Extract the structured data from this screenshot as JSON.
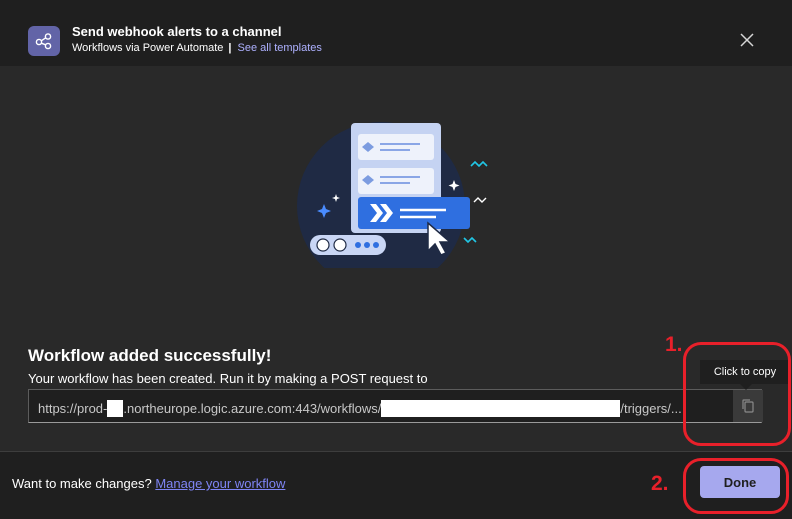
{
  "header": {
    "title": "Send webhook alerts to a channel",
    "subtitle_source": "Workflows via Power Automate",
    "separator": "|",
    "templates_link": "See all templates",
    "close_icon": "close-icon",
    "app_icon": "share-nodes-icon"
  },
  "main": {
    "heading": "Workflow added successfully!",
    "description": "Your workflow has been created. Run it by making a POST request to",
    "url_part1": "https://prod-",
    "url_part2": ".northeurope.logic.azure.com:443/workflows/",
    "url_part3": "/triggers/...",
    "copy_icon": "copy-icon",
    "tooltip": "Click to copy"
  },
  "footer": {
    "prompt": "Want to make changes?",
    "manage_link": "Manage your workflow",
    "done_label": "Done"
  },
  "annotations": {
    "label_1": "1.",
    "label_2": "2."
  },
  "colors": {
    "accent": "#6264a7",
    "link": "#7f85f5",
    "done_button": "#a6a8ee",
    "annotation_red": "#e8202a"
  }
}
